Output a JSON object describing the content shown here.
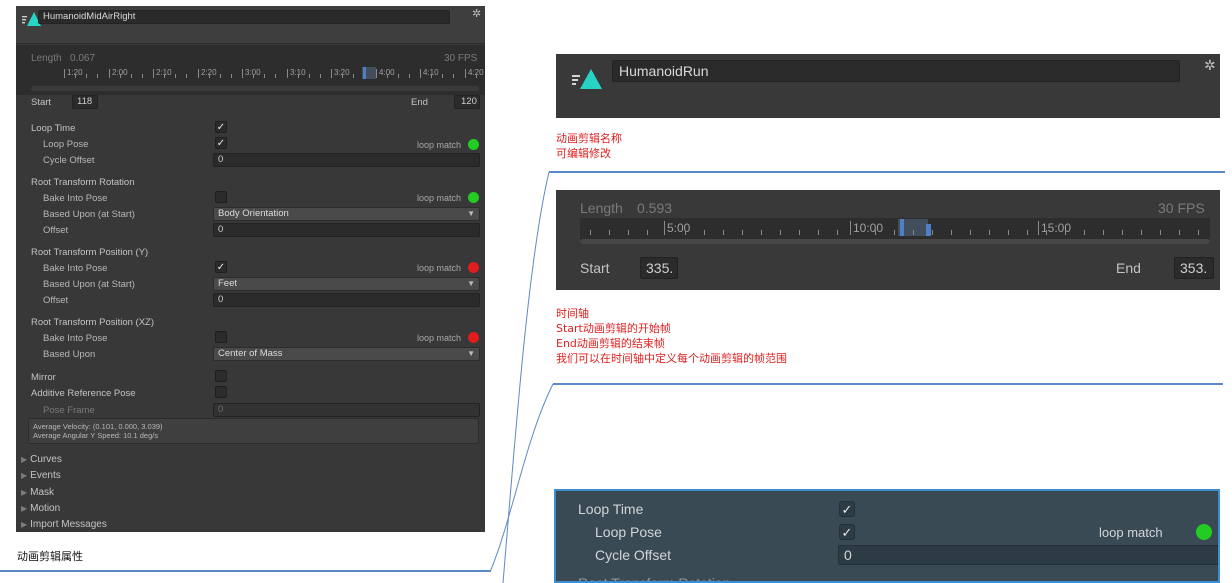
{
  "left": {
    "clip_name": "HumanoidMidAirRight",
    "length_label": "Length",
    "length_value": "0.067",
    "fps": "30 FPS",
    "ticks": [
      "1:20",
      "2:00",
      "2:10",
      "2:20",
      "3:00",
      "3:10",
      "3:20",
      "4:00",
      "4:10",
      "4:20"
    ],
    "start_label": "Start",
    "start_value": "118",
    "end_label": "End",
    "end_value": "120",
    "loop_time": "Loop Time",
    "loop_pose": "Loop Pose",
    "loop_match": "loop match",
    "cycle_offset": "Cycle Offset",
    "cycle_offset_value": "0",
    "rtr_header": "Root Transform Rotation",
    "bake_into_pose": "Bake Into Pose",
    "based_upon_start": "Based Upon (at Start)",
    "rtr_based_value": "Body Orientation",
    "offset": "Offset",
    "rtr_offset_value": "0",
    "rtpy_header": "Root Transform Position (Y)",
    "rtpy_based_value": "Feet",
    "rtpy_offset_value": "0",
    "rtpxz_header": "Root Transform Position (XZ)",
    "based_upon": "Based Upon",
    "rtpxz_based_value": "Center of Mass",
    "mirror": "Mirror",
    "additive_ref_pose": "Additive Reference Pose",
    "pose_frame": "Pose Frame",
    "pose_frame_value": "0",
    "info_line1": "Average Velocity: (0.101, 0.000, 3.039)",
    "info_line2": "Average Angular Y Speed: 10.1 deg/s",
    "foldouts": [
      "Curves",
      "Events",
      "Mask",
      "Motion",
      "Import Messages"
    ],
    "caption": "动画剪辑属性"
  },
  "right": {
    "clip_name": "HumanoidRun",
    "note1_line1": "动画剪辑名称",
    "note1_line2": "可编辑修改",
    "length_label": "Length",
    "length_value": "0.593",
    "fps": "30 FPS",
    "ticks": [
      "5:00",
      "10:00",
      "15:00"
    ],
    "start_label": "Start",
    "start_value": "335.",
    "end_label": "End",
    "end_value": "353.",
    "note2_lines": [
      "时间轴",
      "Start动画剪辑的开始帧",
      "End动画剪辑的结束帧",
      "我们可以在时间轴中定义每个动画剪辑的帧范围"
    ],
    "zoom": {
      "loop_time": "Loop Time",
      "loop_pose": "Loop Pose",
      "loop_match": "loop match",
      "cycle_offset": "Cycle Offset",
      "cycle_offset_value": "0",
      "cut_header": "Root Transform Rotation"
    }
  },
  "colors": {
    "match_green": "#22cc22",
    "match_red": "#e01c1c",
    "note_red": "#e02020",
    "rule_blue": "#5b8ac6",
    "clip_icon_teal": "#27d3c2"
  },
  "checks": {
    "loop_time": true,
    "loop_pose": true,
    "rtr_bake": false,
    "rtpy_bake": true,
    "rtpxz_bake": false,
    "mirror": false,
    "additive": false
  },
  "icons": {
    "clip": "animation-clip-icon",
    "settings": "gear-icon",
    "foldout": "triangle-right-icon"
  }
}
